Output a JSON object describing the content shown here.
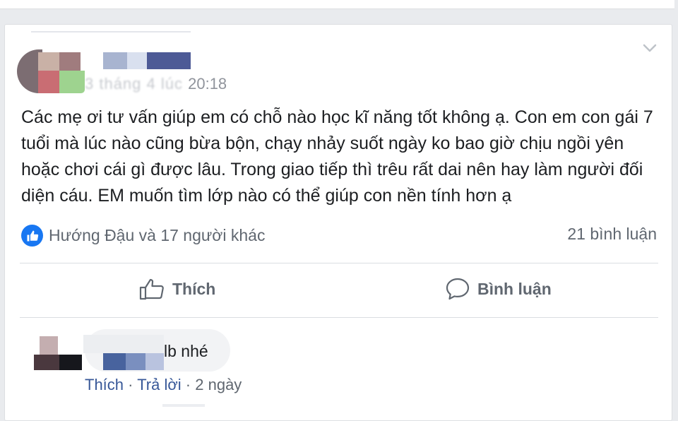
{
  "post": {
    "time_visible": "20:18",
    "time_blurred": "3 tháng 4 lúc ",
    "text": "Các mẹ ơi tư vấn giúp em có chỗ nào học kĩ năng tốt không ạ. Con em con gái 7 tuổi mà lúc nào cũng bừa bộn, chạy nhảy suốt ngày ko bao giờ chịu ngồi yên hoặc chơi cái gì được lâu. Trong giao tiếp thì trêu rất dai nên hay làm người đối diện cáu. EM muốn tìm lớp nào có thể giúp con nền tính hơn ạ",
    "reactions_text": "Hướng Đậu và 17 người khác",
    "comment_count": "21 bình luận",
    "like_icon": "thumbs-up-icon",
    "menu_icon": "chevron-down-icon"
  },
  "actions": {
    "like_label": "Thích",
    "comment_label": "Bình luận"
  },
  "comment": {
    "text": "lb nhé",
    "like_label": "Thích",
    "reply_label": "Trả lời",
    "separator": " · ",
    "age": "2 ngày"
  },
  "colors": {
    "background": "#e9ebee",
    "card": "#ffffff",
    "accent_blue": "#1877f2",
    "link_blue": "#385898",
    "meta_gray": "#606770",
    "bubble": "#f2f3f5"
  }
}
